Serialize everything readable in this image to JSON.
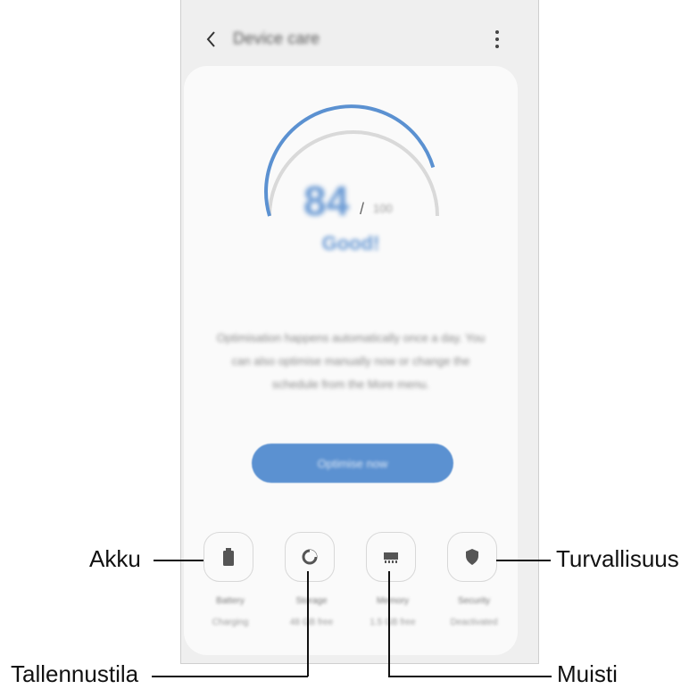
{
  "appbar": {
    "title": "Device care"
  },
  "score": {
    "value": "84",
    "max": "100",
    "fraction": 0.84,
    "status": "Good!"
  },
  "description": "Optimisation happens automatically once a day. You can also optimise manually now or change the schedule from the More menu.",
  "optimize_button": "Optimise now",
  "tiles": [
    {
      "icon": "battery-icon",
      "label": "Battery",
      "sub": "Charging"
    },
    {
      "icon": "storage-icon",
      "label": "Storage",
      "sub": "48 GB free"
    },
    {
      "icon": "memory-icon",
      "label": "Memory",
      "sub": "1.5 GB free"
    },
    {
      "icon": "security-icon",
      "label": "Security",
      "sub": "Deactivated"
    }
  ],
  "callouts": {
    "battery": "Akku",
    "storage": "Tallennustila",
    "memory": "Muisti",
    "security": "Turvallisuus"
  },
  "colors": {
    "accent": "#5b91d1",
    "gauge_track": "#d9d9d9",
    "background": "#efefef"
  }
}
